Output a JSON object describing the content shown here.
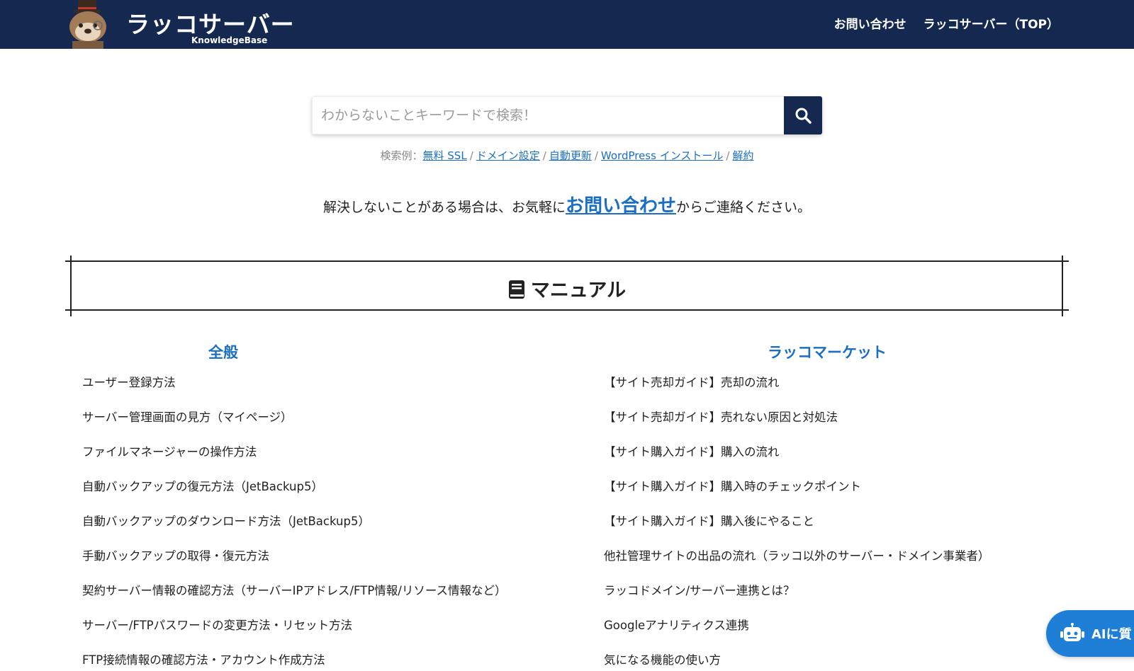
{
  "header": {
    "logo_title": "ラッコサーバー",
    "logo_sub": "KnowledgeBase",
    "nav": [
      "お問い合わせ",
      "ラッコサーバー（TOP）"
    ]
  },
  "search": {
    "placeholder": "わからないことキーワードで検索！",
    "examples_label": "検索例：",
    "examples": [
      "無料 SSL",
      "ドメイン設定",
      "自動更新",
      "WordPress インストール",
      "解約"
    ]
  },
  "contact": {
    "before": "解決しないことがある場合は、お気軽に",
    "link": "お問い合わせ",
    "after": "からご連絡ください。"
  },
  "section": {
    "title": "マニュアル",
    "icon": "book-icon"
  },
  "columns": {
    "left": {
      "heading": "全般",
      "items": [
        "ユーザー登録方法",
        "サーバー管理画面の見方（マイページ）",
        "ファイルマネージャーの操作方法",
        "自動バックアップの復元方法（JetBackup5）",
        "自動バックアップのダウンロード方法（JetBackup5）",
        "手動バックアップの取得・復元方法",
        "契約サーバー情報の確認方法（サーバーIPアドレス/FTP情報/リソース情報など）",
        "サーバー/FTPパスワードの変更方法・リセット方法",
        "FTP接続情報の確認方法・アカウント作成方法"
      ]
    },
    "right": {
      "heading": "ラッコマーケット",
      "items": [
        "【サイト売却ガイド】売却の流れ",
        "【サイト売却ガイド】売れない原因と対処法",
        "【サイト購入ガイド】購入の流れ",
        "【サイト購入ガイド】購入時のチェックポイント",
        "【サイト購入ガイド】購入後にやること",
        "他社管理サイトの出品の流れ（ラッコ以外のサーバー・ドメイン事業者）",
        "ラッコドメイン/サーバー連携とは？",
        "Googleアナリティクス連携",
        "気になる機能の使い方"
      ]
    }
  },
  "ai_button": {
    "label": "AIに質",
    "icon": "robot-icon"
  },
  "colors": {
    "header_bg": "#142850",
    "link_blue": "#1a6fc4",
    "ai_button": "#1f7fd6"
  }
}
